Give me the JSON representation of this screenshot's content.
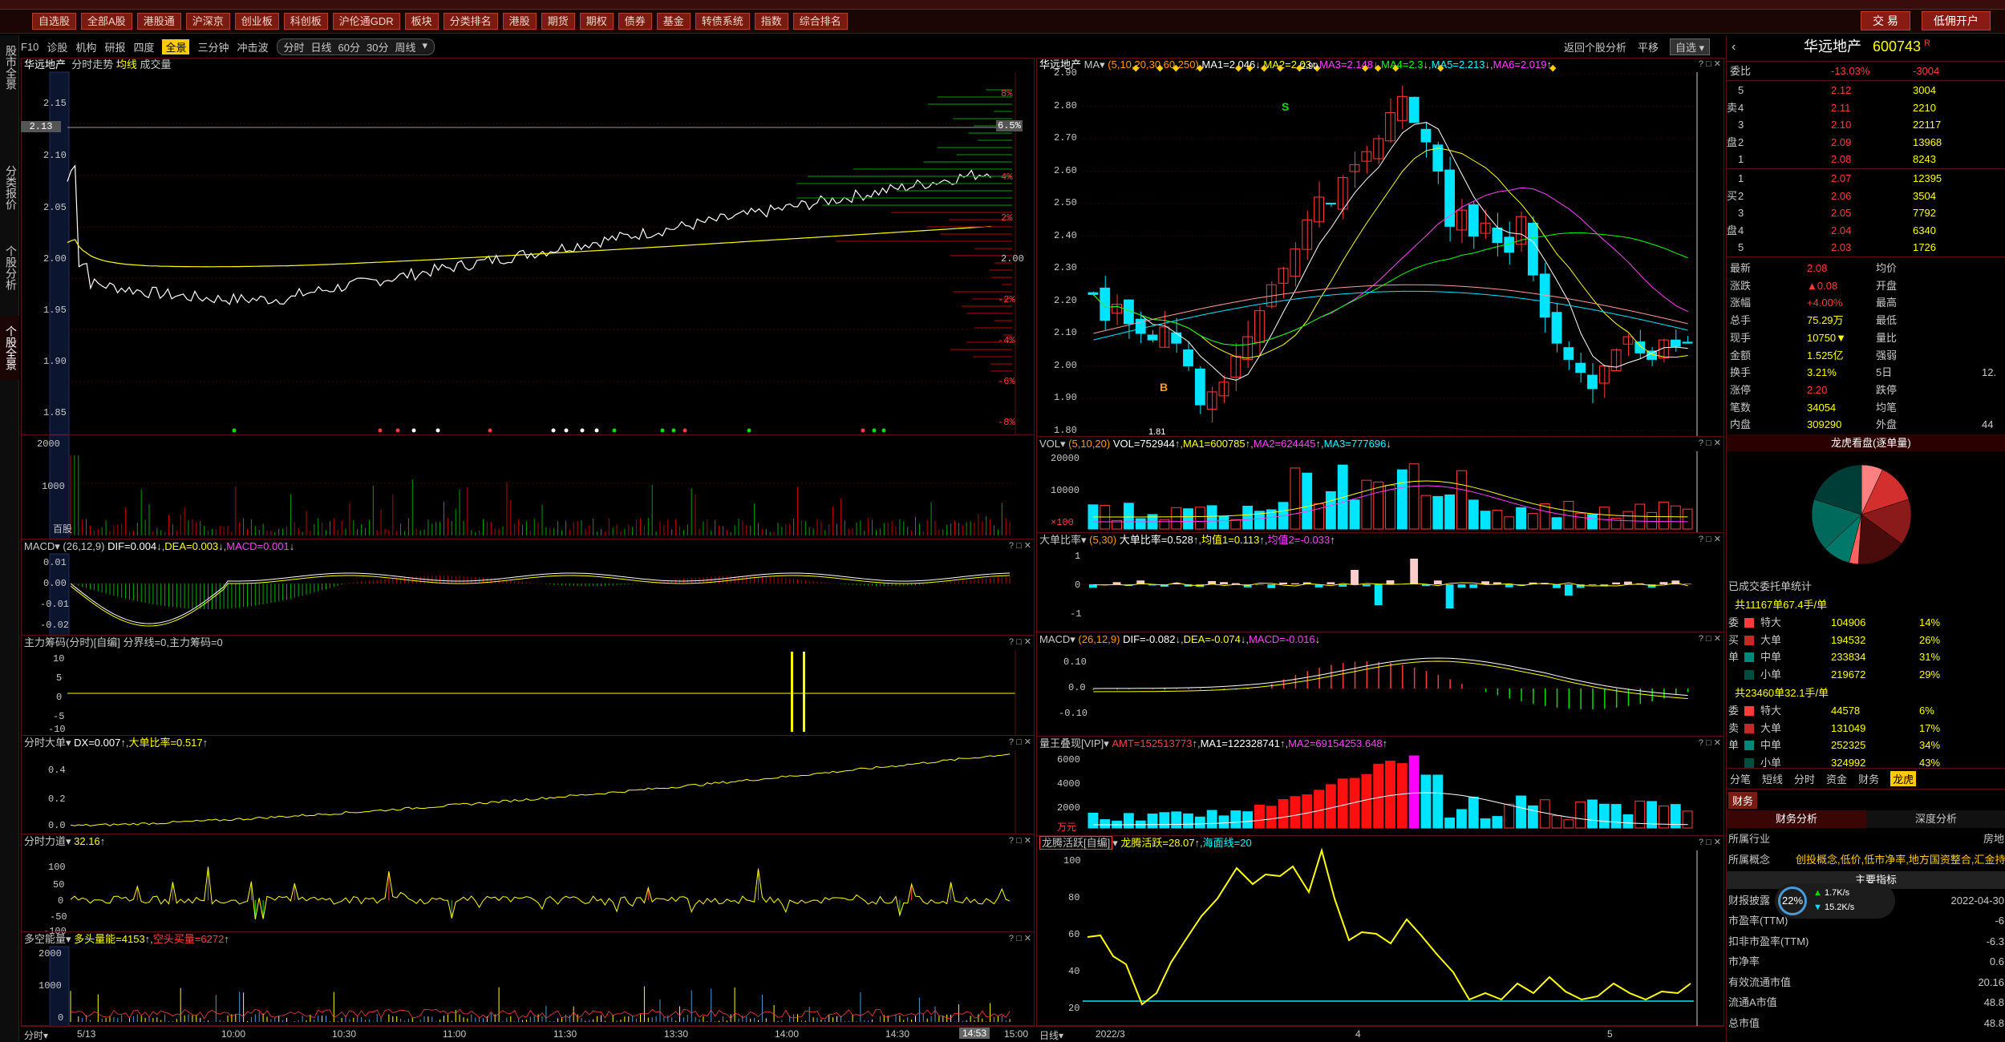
{
  "toolbar": {
    "items": [
      "自选股",
      "全部A股",
      "港股通",
      "沪深京",
      "创业板",
      "科创板",
      "沪伦通GDR",
      "板块",
      "分类排名",
      "港股",
      "期货",
      "期权",
      "债券",
      "基金",
      "转债系统",
      "指数",
      "综合排名"
    ],
    "trade": "交 易",
    "open_account": "低佣开户"
  },
  "leftnav": {
    "tabs": [
      "股市全景",
      "分类报价",
      "个股分析",
      "个股全景"
    ]
  },
  "subbar": {
    "items": [
      "F10",
      "诊股",
      "机构",
      "研报",
      "四度",
      "全景",
      "三分钟",
      "冲击波",
      "分时",
      "日线",
      "60分",
      "30分"
    ],
    "active": "全景",
    "period": "周线",
    "back": "返回个股分析",
    "flat": "平移",
    "watch": "自选"
  },
  "left": {
    "price_panel": {
      "name": "华远地产",
      "title": "分时走势",
      "avg_label": "均线",
      "vol_label": "成交量",
      "price_ticks": [
        "2.15",
        "2.10",
        "2.05",
        "2.00",
        "1.95",
        "1.90",
        "1.85"
      ],
      "pct_ticks": [
        "8%",
        "6.5%",
        "4%",
        "2%",
        "2.00",
        "-2%",
        "-4%",
        "-6%",
        "-8%"
      ],
      "cur_price": "2.13"
    },
    "vol_panel": {
      "ticks": [
        "2000",
        "1000",
        "0"
      ],
      "unit": "百股"
    },
    "macd": {
      "name": "MACD",
      "params": "(26,12,9)",
      "dif": "DIF=0.004",
      "dea": "DEA=0.003",
      "macd": "MACD=0.001",
      "ticks": [
        "0.01",
        "0.00",
        "-0.01",
        "-0.02"
      ]
    },
    "chips": {
      "name": "主力筹码(分时)[自编]",
      "text": "分界线=0,主力筹码=0",
      "ticks": [
        "10",
        "5",
        "0",
        "-5",
        "-10"
      ]
    },
    "bigorder": {
      "name": "分时大单",
      "text": "DX=0.007",
      "text2": "大单比率=0.517",
      "ticks": [
        "0.4",
        "0.2",
        "0.0"
      ]
    },
    "force": {
      "name": "分时力道",
      "text": "32.16",
      "ticks": [
        "100",
        "50",
        "0",
        "-50",
        "-100"
      ]
    },
    "longshort": {
      "name": "多空能量",
      "text": "多头量能=4153",
      "text2": "空头买量=6272",
      "ticks": [
        "2000",
        "1000",
        "0"
      ]
    },
    "time_ticks": [
      "5/13",
      "10:00",
      "10:30",
      "11:00",
      "11:30",
      "13:30",
      "14:00",
      "14:30",
      "14:53",
      "15:00"
    ],
    "status_left": "分时"
  },
  "right": {
    "kline": {
      "name": "华远地产",
      "ma_label": "MA",
      "params": "(5,10,20,30,60,250)",
      "ma1": "MA1=2.046",
      "ma2": "MA2=2.03",
      "ma3": "MA3=2.148",
      "ma4": "MA4=2.3",
      "ma5": "MA5=2.213",
      "ma6": "MA6=2.019",
      "ticks": [
        "2.90",
        "2.80",
        "2.70",
        "2.60",
        "2.50",
        "2.40",
        "2.30",
        "2.20",
        "2.10",
        "2.00",
        "1.90",
        "1.80"
      ],
      "hi": "2.90",
      "lo": "1.81",
      "buy": "B",
      "sell": "S"
    },
    "vol": {
      "name": "VOL",
      "params": "(5,10,20)",
      "v": "VOL=752944",
      "ma1": "MA1=600785",
      "ma2": "MA2=624445",
      "ma3": "MA3=777696",
      "ticks": [
        "20000",
        "10000",
        "×100"
      ]
    },
    "bigratio": {
      "name": "大单比率",
      "params": "(5,30)",
      "v": "大单比率=0.528",
      "a1": "均值1=0.113",
      "a2": "均值2=-0.033",
      "ticks": [
        "1",
        "0",
        "-1"
      ]
    },
    "macd": {
      "name": "MACD",
      "params": "(26,12,9)",
      "dif": "DIF=-0.082",
      "dea": "DEA=-0.074",
      "macd": "MACD=-0.016",
      "ticks": [
        "0.10",
        "0.0",
        "-0.10"
      ]
    },
    "amt": {
      "name": "量王叠现[VIP]",
      "amt": "AMT=152513773",
      "ma1": "MA1=122328741",
      "ma2": "MA2=69154253.648",
      "ticks": [
        "6000",
        "4000",
        "2000",
        "万元"
      ]
    },
    "dragon": {
      "name": "龙腾活跃[自编]",
      "v": "龙腾活跃=28.07",
      "sea": "海面线=20",
      "ticks": [
        "100",
        "80",
        "60",
        "40",
        "20"
      ]
    },
    "date_ticks": [
      "2022/3",
      "4",
      "5"
    ],
    "status_left": "日线"
  },
  "side": {
    "name": "华远地产",
    "code": "600743",
    "mark": "R",
    "weibi_label": "委比",
    "weibi": "-13.03%",
    "weibi_val": "-3004",
    "sells": [
      [
        "5",
        "2.12",
        "3004"
      ],
      [
        "4",
        "2.11",
        "2210"
      ],
      [
        "3",
        "2.10",
        "22117"
      ],
      [
        "2",
        "2.09",
        "13968"
      ],
      [
        "1",
        "2.08",
        "8243"
      ]
    ],
    "buys": [
      [
        "1",
        "2.07",
        "12395"
      ],
      [
        "2",
        "2.06",
        "3504"
      ],
      [
        "3",
        "2.05",
        "7792"
      ],
      [
        "4",
        "2.04",
        "6340"
      ],
      [
        "5",
        "2.03",
        "1726"
      ]
    ],
    "sell_label": "卖",
    "buy_label": "买",
    "pan_label": "盘",
    "quote": [
      [
        "最新",
        "2.08",
        "均价",
        ""
      ],
      [
        "涨跌",
        "▲0.08",
        "开盘",
        ""
      ],
      [
        "涨幅",
        "+4.00%",
        "最高",
        ""
      ],
      [
        "总手",
        "75.29万",
        "最低",
        ""
      ],
      [
        "现手",
        "10750▼",
        "量比",
        ""
      ],
      [
        "金额",
        "1.525亿",
        "强弱",
        ""
      ],
      [
        "换手",
        "3.21%",
        "5日",
        "12."
      ],
      [
        "涨停",
        "2.20",
        "跌停",
        ""
      ],
      [
        "笔数",
        "34054",
        "均笔",
        ""
      ],
      [
        "内盘",
        "309290",
        "外盘",
        "44"
      ]
    ],
    "pie_title": "龙虎看盘(逐单量)",
    "stats_title": "已成交委托单统计",
    "buy_summary": "共11167单67.4手/单",
    "buy_rows": [
      [
        "特大",
        "104906",
        "14%"
      ],
      [
        "大单",
        "194532",
        "26%"
      ],
      [
        "中单",
        "233834",
        "31%"
      ],
      [
        "小单",
        "219672",
        "29%"
      ]
    ],
    "buy_side": [
      "委",
      "买",
      "单"
    ],
    "sell_summary": "共23460单32.1手/单",
    "sell_rows": [
      [
        "特大",
        "44578",
        "6%"
      ],
      [
        "大单",
        "131049",
        "17%"
      ],
      [
        "中单",
        "252325",
        "34%"
      ],
      [
        "小单",
        "324992",
        "43%"
      ]
    ],
    "sell_side": [
      "委",
      "卖",
      "单"
    ],
    "tabs": [
      "分笔",
      "短线",
      "分时",
      "资金",
      "财务",
      "龙虎"
    ],
    "tab_active": "龙虎",
    "fin_tab": "财务",
    "fin_sub": [
      "财务分析",
      "深度分析"
    ],
    "info": [
      [
        "所属行业",
        "房地"
      ],
      [
        "所属概念",
        "创投概念,低价,低市净率,地方国资整合,汇金持股"
      ],
      [
        "",
        "主要指标"
      ],
      [
        "财报披露",
        "2022-04-30"
      ],
      [
        "市盈率(TTM)",
        "-6"
      ],
      [
        "扣非市盈率(TTM)",
        "-6.3"
      ],
      [
        "市净率",
        "0.6"
      ],
      [
        "有效流通市值",
        "20.16"
      ],
      [
        "流通A市值",
        "48.8"
      ],
      [
        "总市值",
        "48.8"
      ]
    ],
    "net_pct": "22%",
    "net_up": "1.7K/s",
    "net_down": "15.2K/s"
  },
  "colors": {
    "up": "#ff3b3b",
    "down": "#00e5ff",
    "grid": "#5a1010",
    "ma_yellow": "#ffff00",
    "ma_white": "#ffffff",
    "ma_pink": "#ff40ff",
    "ma_green": "#00ff00"
  }
}
